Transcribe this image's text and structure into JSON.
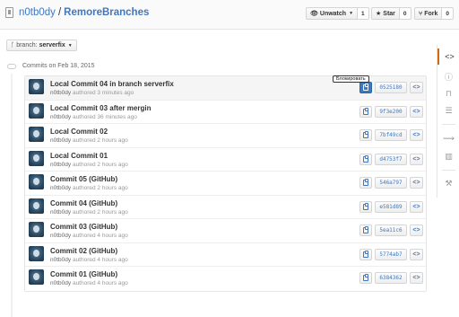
{
  "repo": {
    "owner": "n0tb0dy",
    "separator": "/",
    "name": "RemoreBranches",
    "icon": "repo-icon"
  },
  "actions": {
    "watch": {
      "label": "Unwatch",
      "count": "1",
      "icon": "eye-icon"
    },
    "star": {
      "label": "Star",
      "count": "0",
      "icon": "star-icon"
    },
    "fork": {
      "label": "Fork",
      "count": "0",
      "icon": "fork-icon"
    }
  },
  "branch": {
    "label": "branch:",
    "value": "serverfix"
  },
  "group_label": "Commits on Feb 18, 2015",
  "tooltip": "Блокировать",
  "commits": [
    {
      "title": "Local Commit 04 in branch serverfix",
      "author": "n0tb0dy",
      "when": "authored 3 minutes ago",
      "sha": "0525180"
    },
    {
      "title": "Local Commit 03 after mergin",
      "author": "n0tb0dy",
      "when": "authored 36 minutes ago",
      "sha": "9f3e200"
    },
    {
      "title": "Local Commit 02",
      "author": "n0tb0dy",
      "when": "authored 2 hours ago",
      "sha": "7bf49cd"
    },
    {
      "title": "Local Commit 01",
      "author": "n0tb0dy",
      "when": "authored 2 hours ago",
      "sha": "d4753f7"
    },
    {
      "title": "Commit 05 (GitHub)",
      "author": "n0tb0dy",
      "when": "authored 2 hours ago",
      "sha": "546a797"
    },
    {
      "title": "Commit 04 (GitHub)",
      "author": "n0tb0dy",
      "when": "authored 2 hours ago",
      "sha": "e581d89"
    },
    {
      "title": "Commit 03 (GitHub)",
      "author": "n0tb0dy",
      "when": "authored 4 hours ago",
      "sha": "5ea11c6"
    },
    {
      "title": "Commit 02 (GitHub)",
      "author": "n0tb0dy",
      "when": "authored 4 hours ago",
      "sha": "5774ab7"
    },
    {
      "title": "Commit 01 (GitHub)",
      "author": "n0tb0dy",
      "when": "authored 4 hours ago",
      "sha": "6384362"
    }
  ],
  "sidenav": [
    "code-icon",
    "issues-icon",
    "pull-requests-icon",
    "wiki-icon",
    "pulse-icon",
    "graphs-icon",
    "settings-icon"
  ],
  "colors": {
    "link": "#4078c0",
    "active_tab": "#d26911"
  }
}
